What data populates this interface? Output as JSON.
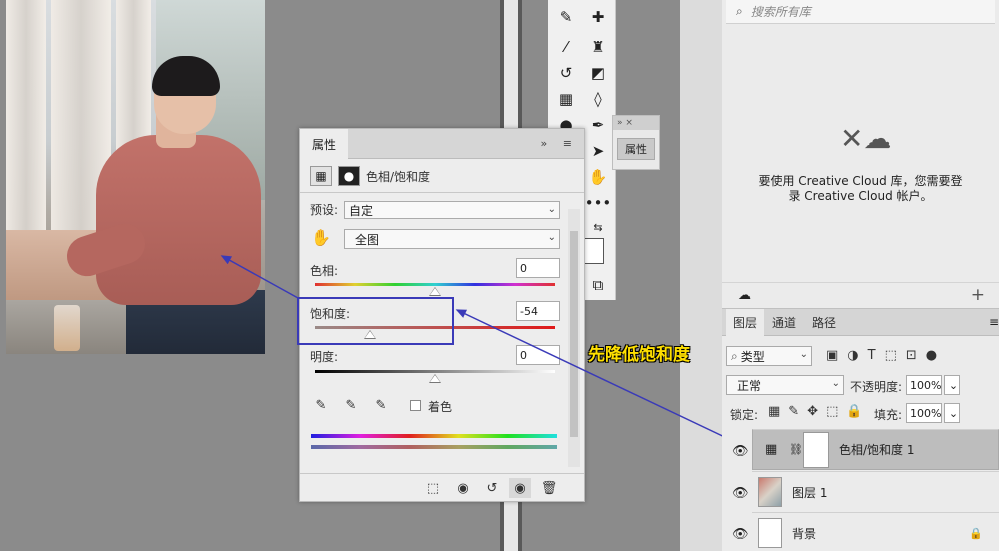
{
  "tools_panel": {
    "tools": [
      "eyedropper-icon",
      "healing-brush-icon",
      "brush-icon",
      "stamp-icon",
      "history-brush-icon",
      "eraser-icon",
      "gradient-icon",
      "blur-icon",
      "dodge-icon",
      "pen-icon",
      "path-select-icon",
      "hand-icon",
      "more-icon",
      "swap-colors-icon",
      "screen-mode-icon"
    ]
  },
  "mini_props": {
    "controls": "»  ×",
    "label": "属性"
  },
  "properties": {
    "tab": "属性",
    "header_icons": "» ≡",
    "type_label": "色相/饱和度",
    "preset_label": "预设:",
    "preset_value": "自定",
    "range_value": "全图",
    "hue_label": "色相:",
    "hue_value": "0",
    "hue_level": 0.5,
    "saturation_label": "饱和度:",
    "saturation_value": "-54",
    "saturation_level": 0.23,
    "lightness_label": "明度:",
    "lightness_value": "0",
    "lightness_level": 0.5,
    "colorize_label": "着色"
  },
  "annotation": {
    "text": "先降低饱和度",
    "color": "#ffe000",
    "box_color": "#3a3ab8"
  },
  "libraries": {
    "search_placeholder": "搜索所有库",
    "message_line1": "要使用 Creative Cloud 库，您需要登",
    "message_line2": "录 Creative Cloud 帐户。"
  },
  "layers": {
    "tabs": [
      "图层",
      "通道",
      "路径"
    ],
    "filter_label": "类型",
    "blend_mode": "正常",
    "opacity_label": "不透明度:",
    "opacity_value": "100%",
    "lock_label": "锁定:",
    "fill_label": "填充:",
    "fill_value": "100%",
    "items": [
      {
        "name": "色相/饱和度 1",
        "selected": true
      },
      {
        "name": "图层 1",
        "selected": false
      },
      {
        "name": "背景",
        "selected": false
      }
    ]
  }
}
